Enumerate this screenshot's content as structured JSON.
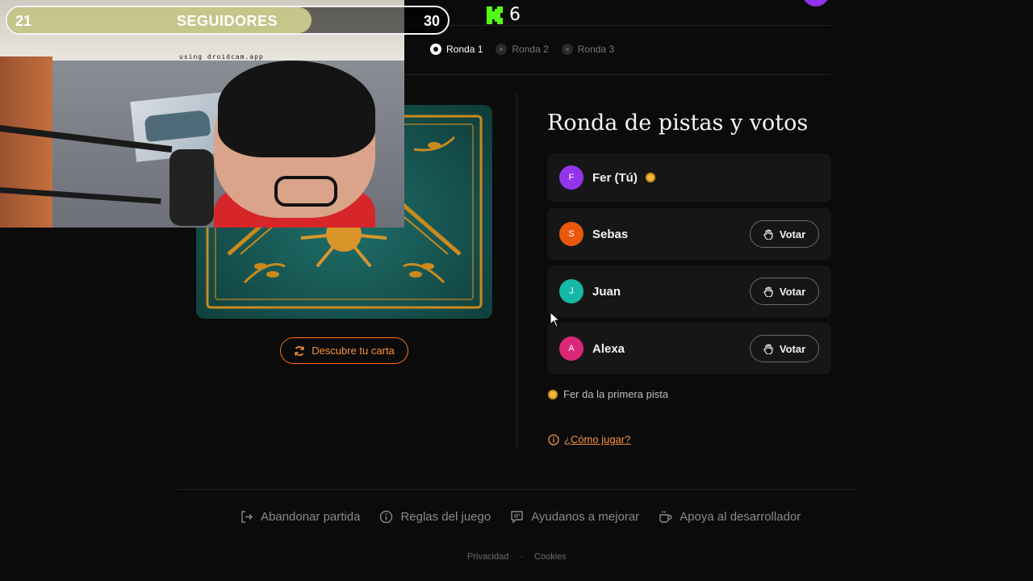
{
  "stream_overlay": {
    "goal_start": "21",
    "goal_label": "SEGUIDORES",
    "goal_end": "30",
    "goal_progress": 0.69,
    "watermark": "using droidcam.app"
  },
  "header": {
    "kick_icon": "kick-logo-icon",
    "kick_count": "6"
  },
  "rounds": [
    {
      "label": "Ronda 1",
      "state": "active"
    },
    {
      "label": "Ronda 2",
      "state": "idle"
    },
    {
      "label": "Ronda 3",
      "state": "idle"
    }
  ],
  "card": {
    "discover_label": "Descubre tu carta",
    "discover_icon": "refresh-icon"
  },
  "panel": {
    "title": "Ronda de pistas y votos",
    "players": [
      {
        "initial": "F",
        "name": "Fer (Tú)",
        "color": "#9333ea",
        "has_sun": true,
        "votable": false
      },
      {
        "initial": "S",
        "name": "Sebas",
        "color": "#ea580c",
        "votable": true
      },
      {
        "initial": "J",
        "name": "Juan",
        "color": "#14b8a6",
        "votable": true
      },
      {
        "initial": "A",
        "name": "Alexa",
        "color": "#db2777",
        "votable": true
      }
    ],
    "vote_label": "Votar",
    "vote_icon": "hand-icon",
    "first_clue": "Fer da la primera pista",
    "howto": "¿Cómo jugar?"
  },
  "footer": {
    "links": [
      {
        "icon": "exit-icon",
        "label": "Abandonar partida"
      },
      {
        "icon": "info-icon",
        "label": "Reglas del juego"
      },
      {
        "icon": "feedback-icon",
        "label": "Ayudanos a mejorar"
      },
      {
        "icon": "coffee-icon",
        "label": "Apoya al desarrollador"
      }
    ],
    "privacy": "Privacidad",
    "separator": "·",
    "cookies": "Cookies"
  },
  "colors": {
    "accent": "#f97316",
    "background": "#0b0b0b",
    "card_teal": "#1f6f69",
    "card_gold": "#c98a1d"
  }
}
